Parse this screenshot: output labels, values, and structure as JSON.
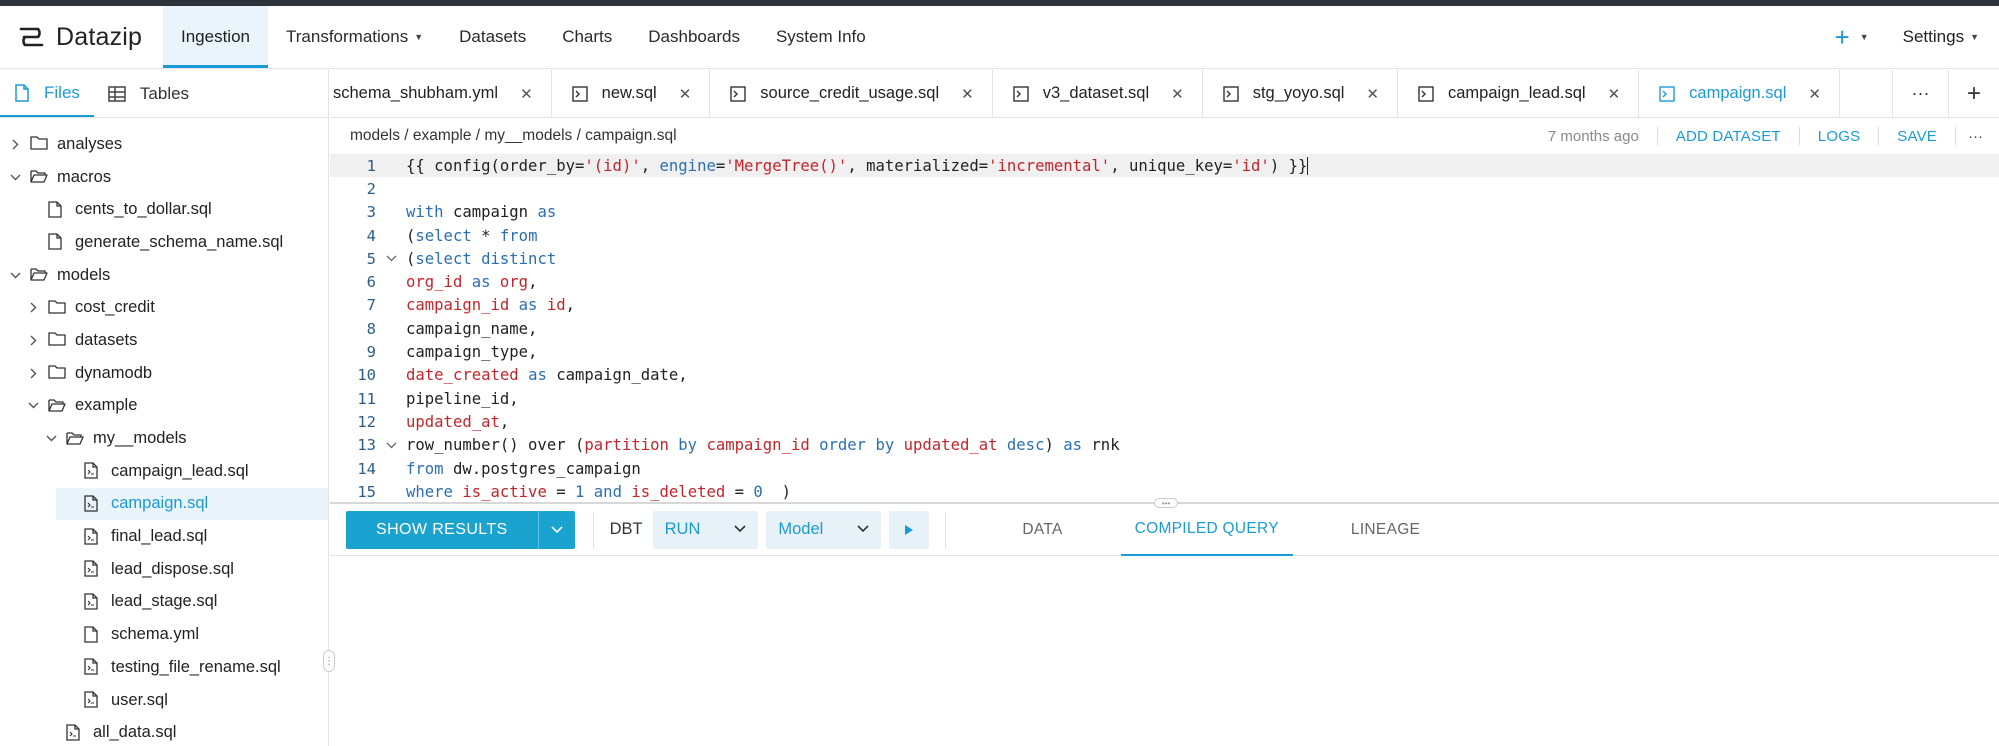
{
  "app": {
    "name": "Datazip"
  },
  "nav": {
    "items": [
      {
        "label": "Ingestion",
        "active": true
      },
      {
        "label": "Transformations",
        "dropdown": true
      },
      {
        "label": "Datasets"
      },
      {
        "label": "Charts"
      },
      {
        "label": "Dashboards"
      },
      {
        "label": "System Info"
      }
    ],
    "plus": "+",
    "settings": "Settings"
  },
  "sidebar": {
    "tabs": [
      {
        "label": "Files",
        "active": true
      },
      {
        "label": "Tables"
      }
    ],
    "tree": [
      {
        "label": "analyses",
        "type": "folder",
        "depth": 0,
        "open": false
      },
      {
        "label": "macros",
        "type": "folder",
        "depth": 0,
        "open": true
      },
      {
        "label": "cents_to_dollar.sql",
        "type": "file",
        "depth": 1
      },
      {
        "label": "generate_schema_name.sql",
        "type": "file",
        "depth": 1
      },
      {
        "label": "models",
        "type": "folder",
        "depth": 0,
        "open": true
      },
      {
        "label": "cost_credit",
        "type": "folder",
        "depth": 1,
        "open": false
      },
      {
        "label": "datasets",
        "type": "folder",
        "depth": 1,
        "open": false
      },
      {
        "label": "dynamodb",
        "type": "folder",
        "depth": 1,
        "open": false
      },
      {
        "label": "example",
        "type": "folder",
        "depth": 1,
        "open": true
      },
      {
        "label": "my__models",
        "type": "folder",
        "depth": 2,
        "open": true
      },
      {
        "label": "campaign_lead.sql",
        "type": "sqlfile",
        "depth": 3
      },
      {
        "label": "campaign.sql",
        "type": "sqlfile",
        "depth": 3,
        "selected": true
      },
      {
        "label": "final_lead.sql",
        "type": "sqlfile",
        "depth": 3
      },
      {
        "label": "lead_dispose.sql",
        "type": "sqlfile",
        "depth": 3
      },
      {
        "label": "lead_stage.sql",
        "type": "sqlfile",
        "depth": 3
      },
      {
        "label": "schema.yml",
        "type": "file",
        "depth": 3
      },
      {
        "label": "testing_file_rename.sql",
        "type": "sqlfile",
        "depth": 3
      },
      {
        "label": "user.sql",
        "type": "sqlfile",
        "depth": 3
      },
      {
        "label": "all_data.sql",
        "type": "sqlfile",
        "depth": 2
      }
    ]
  },
  "tabs": [
    {
      "label": "schema_shubham.yml",
      "icon": false
    },
    {
      "label": "new.sql",
      "icon": true
    },
    {
      "label": "source_credit_usage.sql",
      "icon": true
    },
    {
      "label": "v3_dataset.sql",
      "icon": true
    },
    {
      "label": "stg_yoyo.sql",
      "icon": true
    },
    {
      "label": "campaign_lead.sql",
      "icon": true
    },
    {
      "label": "campaign.sql",
      "icon": true,
      "active": true
    }
  ],
  "tab_controls": {
    "more": "···",
    "add": "+"
  },
  "breadcrumb": "models / example / my__models / campaign.sql",
  "file_actions": {
    "age": "7 months ago",
    "add_dataset": "ADD DATASET",
    "logs": "LOGS",
    "save": "SAVE",
    "more": "···"
  },
  "code": [
    [
      [
        "t",
        "{{ config(order_by="
      ],
      [
        "s",
        "'(id)'"
      ],
      [
        "t",
        ", "
      ],
      [
        "k",
        "engine"
      ],
      [
        "t",
        "="
      ],
      [
        "s",
        "'MergeTree()'"
      ],
      [
        "t",
        ", materialized="
      ],
      [
        "s",
        "'incremental'"
      ],
      [
        "t",
        ", unique_key="
      ],
      [
        "s",
        "'id'"
      ],
      [
        "t",
        ") }}"
      ]
    ],
    [],
    [
      [
        "k",
        "with"
      ],
      [
        "t",
        " campaign "
      ],
      [
        "k",
        "as"
      ]
    ],
    [
      [
        "t",
        "("
      ],
      [
        "k",
        "select"
      ],
      [
        "t",
        " * "
      ],
      [
        "k",
        "from"
      ]
    ],
    [
      [
        "t",
        "("
      ],
      [
        "k",
        "select distinct"
      ]
    ],
    [
      [
        "r",
        "org_id"
      ],
      [
        "t",
        " "
      ],
      [
        "k",
        "as"
      ],
      [
        "t",
        " "
      ],
      [
        "r",
        "org"
      ],
      [
        "t",
        ","
      ]
    ],
    [
      [
        "r",
        "campaign_id"
      ],
      [
        "t",
        " "
      ],
      [
        "k",
        "as"
      ],
      [
        "t",
        " "
      ],
      [
        "r",
        "id"
      ],
      [
        "t",
        ","
      ]
    ],
    [
      [
        "t",
        "campaign_name,"
      ]
    ],
    [
      [
        "t",
        "campaign_type,"
      ]
    ],
    [
      [
        "r",
        "date_created"
      ],
      [
        "t",
        " "
      ],
      [
        "k",
        "as"
      ],
      [
        "t",
        " campaign_date,"
      ]
    ],
    [
      [
        "t",
        "pipeline_id,"
      ]
    ],
    [
      [
        "r",
        "updated_at"
      ],
      [
        "t",
        ","
      ]
    ],
    [
      [
        "t",
        "row_number() over ("
      ],
      [
        "r",
        "partition"
      ],
      [
        "t",
        " "
      ],
      [
        "k",
        "by"
      ],
      [
        "t",
        " "
      ],
      [
        "r",
        "campaign_id"
      ],
      [
        "t",
        " "
      ],
      [
        "k",
        "order by"
      ],
      [
        "t",
        " "
      ],
      [
        "r",
        "updated_at"
      ],
      [
        "t",
        " "
      ],
      [
        "k",
        "desc"
      ],
      [
        "t",
        ") "
      ],
      [
        "k",
        "as"
      ],
      [
        "t",
        " rnk"
      ]
    ],
    [
      [
        "k",
        "from"
      ],
      [
        "t",
        " dw.postgres_campaign"
      ]
    ],
    [
      [
        "k",
        "where"
      ],
      [
        "t",
        " "
      ],
      [
        "r",
        "is_active"
      ],
      [
        "t",
        " = "
      ],
      [
        "k",
        "1"
      ],
      [
        "t",
        " "
      ],
      [
        "k",
        "and"
      ],
      [
        "t",
        " "
      ],
      [
        "r",
        "is_deleted"
      ],
      [
        "t",
        " = "
      ],
      [
        "k",
        "0"
      ],
      [
        "t",
        "  )"
      ]
    ]
  ],
  "folds": [
    5,
    13
  ],
  "results_bar": {
    "show_results": "SHOW RESULTS",
    "dbt_label": "DBT",
    "run_select": "RUN",
    "model_select": "Model",
    "tabs": [
      {
        "label": "DATA"
      },
      {
        "label": "COMPILED QUERY",
        "active": true
      },
      {
        "label": "LINEAGE"
      }
    ]
  },
  "colors": {
    "accent": "#1a9bd8",
    "button": "#1aa3cf",
    "keyword": "#2a6fb3",
    "identifier": "#c5242b"
  }
}
